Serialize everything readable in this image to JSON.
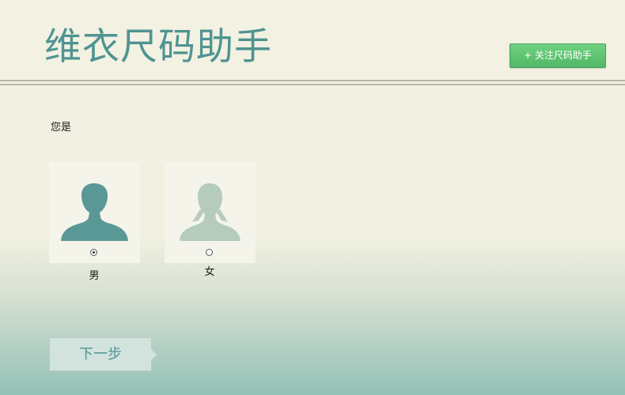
{
  "header": {
    "title": "维衣尺码助手",
    "follow_button_label": "+ 关注尺码助手"
  },
  "question": {
    "label": "您是"
  },
  "gender_options": [
    {
      "id": "male",
      "label": "男",
      "selected": true,
      "icon": "male-avatar-icon",
      "color": "#5a9896"
    },
    {
      "id": "female",
      "label": "女",
      "selected": false,
      "icon": "female-avatar-icon",
      "color": "#b5cbbd"
    }
  ],
  "footer": {
    "next_label": "下一步"
  },
  "colors": {
    "accent": "#4f9491",
    "follow_button": "#5cc06f",
    "background_top": "#f2f1e2",
    "background_bottom": "#93c1b6"
  }
}
